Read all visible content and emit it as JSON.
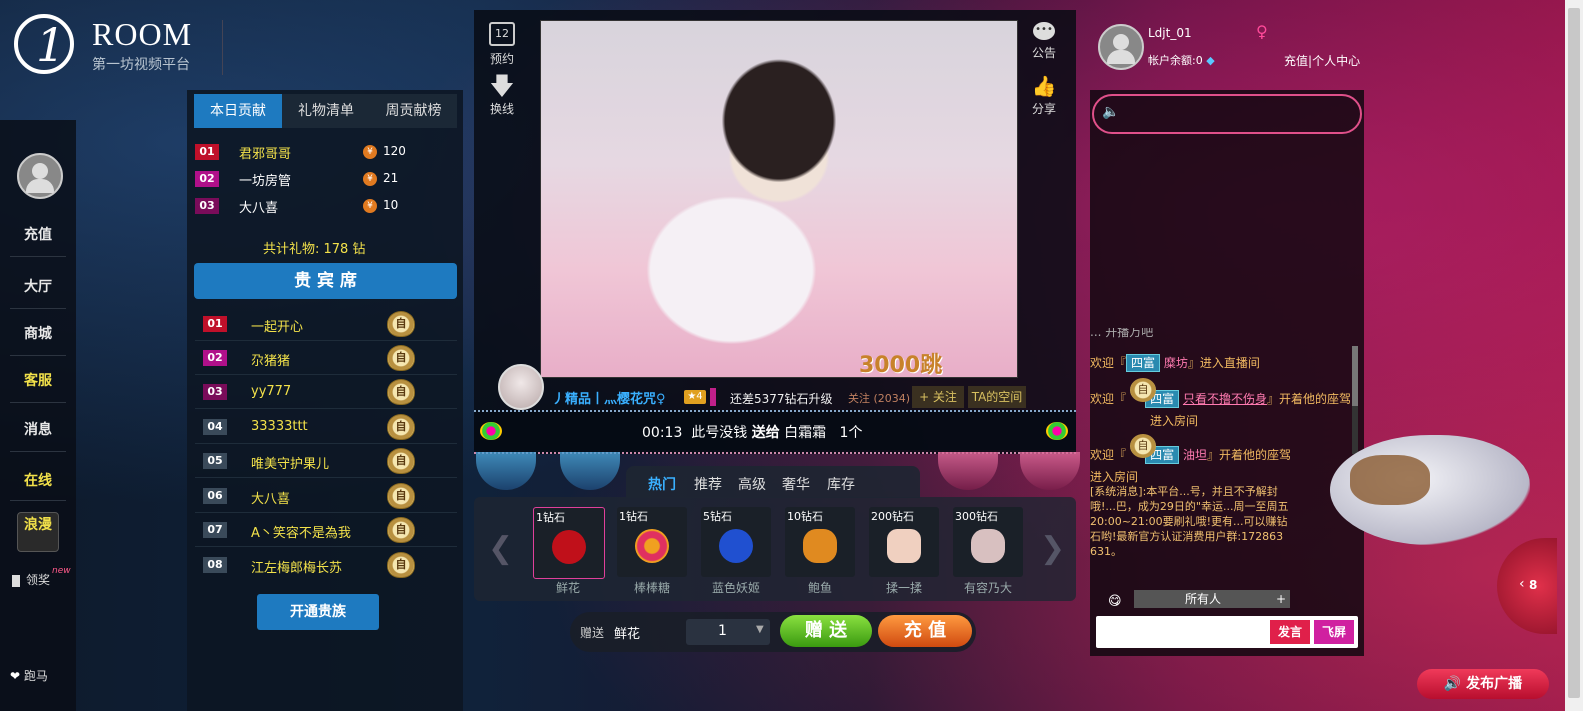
{
  "brand": {
    "name": "ROOM",
    "subtitle": "第一坊视频平台"
  },
  "sidebar": {
    "items": [
      {
        "label": "充值"
      },
      {
        "label": "大厅"
      },
      {
        "label": "商城"
      },
      {
        "label": "客服"
      },
      {
        "label": "消息"
      },
      {
        "label": "在线"
      },
      {
        "label": "浪漫"
      }
    ],
    "claim": "领奖",
    "claim_badge": "new",
    "horse": "跑马"
  },
  "contrib": {
    "tabs": [
      "本日贡献",
      "礼物清单",
      "周贡献榜"
    ],
    "rows": [
      {
        "rank": "01",
        "name": "君邪哥哥",
        "coin": "¥",
        "value": "120"
      },
      {
        "rank": "02",
        "name": "一坊房管",
        "coin": "¥",
        "value": "21"
      },
      {
        "rank": "03",
        "name": "大八喜",
        "coin": "¥",
        "value": "10"
      }
    ],
    "total": "共计礼物: 178 钻"
  },
  "vip": {
    "title": "贵 宾 席",
    "badge_text": "自",
    "rows": [
      {
        "rank": "01",
        "name": "一起开心"
      },
      {
        "rank": "02",
        "name": "尕猪猪"
      },
      {
        "rank": "03",
        "name": "yy777"
      },
      {
        "rank": "04",
        "name": "33333ttt"
      },
      {
        "rank": "05",
        "name": "唯美守护果儿"
      },
      {
        "rank": "06",
        "name": "大八喜"
      },
      {
        "rank": "07",
        "name": "A丶笑容不是為我"
      },
      {
        "rank": "08",
        "name": "江左梅郎梅长苏"
      }
    ],
    "open_button": "开通贵族"
  },
  "controls": {
    "reserve": "预约",
    "reserve_day": "12",
    "switch": "换线",
    "notice": "公告",
    "share": "分享"
  },
  "video": {
    "overlay_text": "3000跳"
  },
  "host": {
    "name": "丿精品丨灬樱花咒♀",
    "level": "4",
    "upgrade": "还差5377钻石升级",
    "follow_count": "关注 (2034)",
    "follow_button": "+ 关注",
    "space_button": "TA的空间"
  },
  "marquee": {
    "time": "00:13",
    "text": "此号没钱",
    "send": "送给",
    "target": "白霜霜",
    "count": "1个"
  },
  "gift_tabs": [
    "热门",
    "推荐",
    "高级",
    "奢华",
    "库存"
  ],
  "gifts": [
    {
      "price": "1钻石",
      "name": "鲜花",
      "color": "#c0101a"
    },
    {
      "price": "1钻石",
      "name": "棒棒糖",
      "color": "#f0a020"
    },
    {
      "price": "5钻石",
      "name": "蓝色妖姬",
      "color": "#2050d0"
    },
    {
      "price": "10钻石",
      "name": "鲍鱼",
      "color": "#e08a20"
    },
    {
      "price": "200钻石",
      "name": "揉一揉",
      "color": "#f0d0c0"
    },
    {
      "price": "300钻石",
      "name": "有容乃大",
      "color": "#d8c0c0"
    }
  ],
  "send_bar": {
    "label": "赠送",
    "gift": "鲜花",
    "qty": "1",
    "send_btn": "赠 送",
    "recharge_btn": "充 值"
  },
  "user": {
    "name": "Ldjt_01",
    "balance": "帐户余额:0",
    "recharge": "充值",
    "sep": "|",
    "center": "个人中心"
  },
  "chat": {
    "top_cut": "   ... 开播万吧",
    "lines": [
      {
        "pre": "欢迎『",
        "tag": "四富",
        "name": "糜坊",
        "post": "』进入直播间"
      },
      {
        "pre": "欢迎『",
        "tag": "四富",
        "name": "只看不撸不伤身",
        "post": "』开着他的座驾",
        "post2": "进入房间"
      },
      {
        "pre": "欢迎『",
        "tag": "四富",
        "name": "油坦",
        "post": "』开着他的座驾",
        "post2": "进入房间"
      }
    ],
    "system": "[系统消息]:本平台...号，并且不予解封哦!...巴，成为29日的\"幸运...周一至周五20:00~21:00要刷礼哦!更有...可以赚钻石哟!最新官方认证消费用户群:172863631。",
    "audience": "所有人",
    "plus": "+",
    "send_btn": "发言",
    "fly_btn": "飞屏"
  },
  "broadcast": "发布广播",
  "side_count": "8"
}
